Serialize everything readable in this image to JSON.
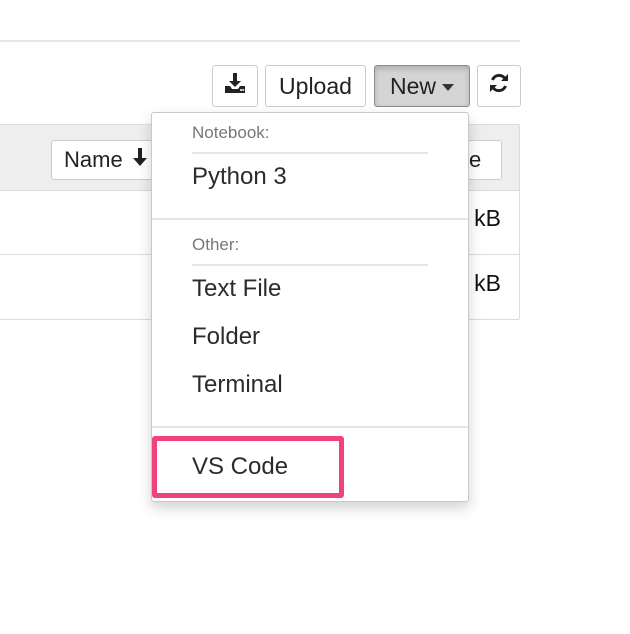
{
  "toolbar": {
    "upload_label": "Upload",
    "new_label": "New",
    "icons": {
      "download": "download-icon",
      "refresh": "refresh-icon",
      "caret": "caret-down-icon"
    }
  },
  "table": {
    "sort_name_label": "Name",
    "sort_size_label": "ze",
    "rows": [
      {
        "size": "kB"
      },
      {
        "size": "kB"
      }
    ]
  },
  "new_menu": {
    "notebook_header": "Notebook:",
    "notebook_items": [
      "Python 3"
    ],
    "other_header": "Other:",
    "other_items": [
      "Text File",
      "Folder",
      "Terminal"
    ],
    "extra_items": [
      "VS Code"
    ]
  },
  "colors": {
    "highlight": "#f0437a",
    "new_button_active": "#d4d4d4"
  }
}
